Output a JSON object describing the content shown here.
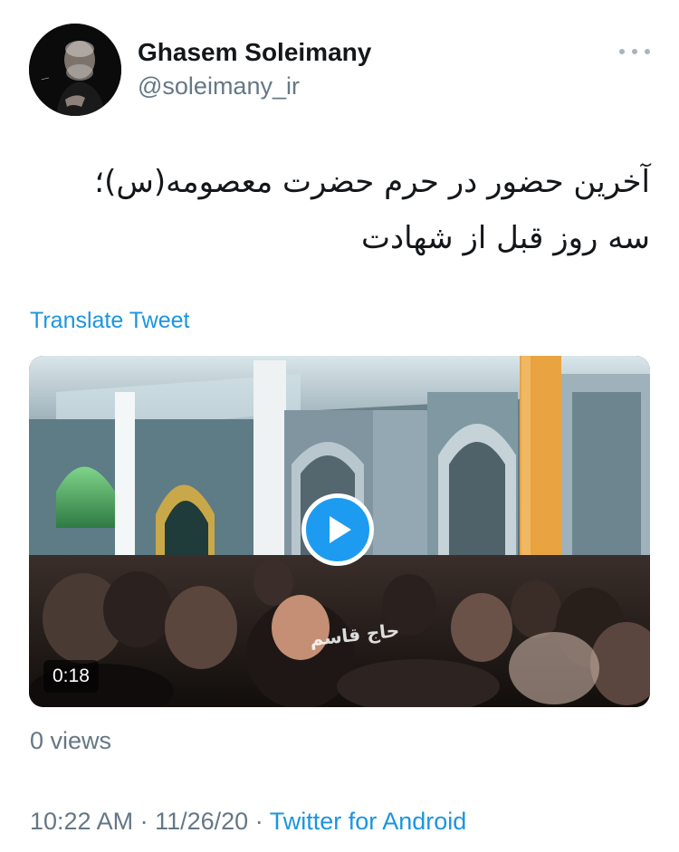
{
  "author": {
    "display_name": "Ghasem Soleimany",
    "handle": "@soleimany_ir"
  },
  "tweet": {
    "text_line1": "آخرین حضور در حرم حضرت معصومه(س)؛",
    "text_line2": "سه روز قبل از شهادت",
    "translate_label": "Translate Tweet"
  },
  "media": {
    "duration": "0:18",
    "watermark": "حاج قاسم"
  },
  "stats": {
    "views": "0 views"
  },
  "meta": {
    "time": "10:22 AM",
    "sep1": " · ",
    "date": "11/26/20",
    "sep2": " · ",
    "source": "Twitter for Android"
  },
  "colors": {
    "link": "#1b95e0",
    "secondary_text": "#657786",
    "play_button": "#1d9bf0"
  },
  "icons": {
    "more": "more-horizontal-icon",
    "play": "play-icon"
  }
}
